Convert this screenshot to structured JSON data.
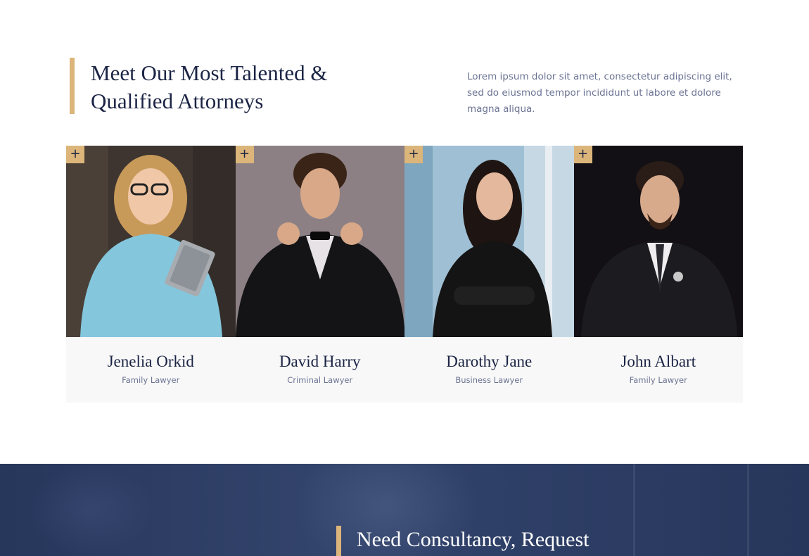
{
  "section": {
    "title_line1": "Meet Our Most Talented &",
    "title_line2": "Qualified Attorneys",
    "intro": "Lorem ipsum dolor sit amet, consectetur adipiscing elit, sed do eiusmod tempor incididunt ut labore et dolore magna aliqua."
  },
  "team": [
    {
      "name": "Jenelia Orkid",
      "role": "Family Lawyer",
      "badge": "+"
    },
    {
      "name": "David Harry",
      "role": "Criminal Lawyer",
      "badge": "+"
    },
    {
      "name": "Darothy Jane",
      "role": "Business Lawyer",
      "badge": "+"
    },
    {
      "name": "John Albart",
      "role": "Family Lawyer",
      "badge": "+"
    }
  ],
  "consultancy": {
    "title": "Need Consultancy, Request"
  },
  "colors": {
    "accent": "#dcb57a",
    "navy": "#1b2444",
    "muted_text": "#6b7393",
    "card_bg": "#f8f8f8",
    "banner_bg": "#2d3c62"
  }
}
